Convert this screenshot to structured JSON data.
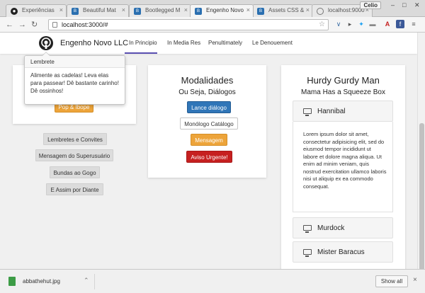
{
  "browser": {
    "tabs": [
      {
        "title": "Experiências",
        "icon": "github-icon"
      },
      {
        "title": "Beautiful Mat",
        "icon": "bootstrap-icon"
      },
      {
        "title": "Bootlegged M",
        "icon": "bootstrap-icon"
      },
      {
        "title": "Engenho Novo",
        "icon": "bootstrap-icon"
      },
      {
        "title": "Assets CSS &",
        "icon": "bootstrap-icon"
      },
      {
        "title": "localhost:9000",
        "icon": "globe-icon"
      }
    ],
    "profile_label": "Celio",
    "url": "localhost:3000/#"
  },
  "navbar": {
    "brand": "Engenho Novo LLC",
    "links": [
      "In Principio",
      "In Media Res",
      "Penultimately",
      "Le Denouement"
    ]
  },
  "left": {
    "popover": {
      "title": "Lembrete",
      "body": "Alimente as cadelas! Leva elas para passear! Dê bastante carinho! Dê ossinhos!"
    },
    "primary_button": "Pop & Ibope",
    "buttons": [
      "Lembretes e Convites",
      "Mensagem do Superusuário",
      "Bundas ao Gogo",
      "E Assim por Diante"
    ]
  },
  "middle": {
    "title": "Modalidades",
    "subtitle": "Ou Seja, Diálogos",
    "buttons": [
      "Lance diálogo",
      "Monólogo Catálogo",
      "Mensagem",
      "Aviso Urgente!"
    ]
  },
  "right": {
    "title": "Hurdy Gurdy Man",
    "subtitle": "Mama Has a Squeeze Box",
    "accordion": [
      {
        "label": "Hannibal",
        "body": "Lorem ipsum dolor sit amet, consectetur adipisicing elit, sed do eiusmod tempor incididunt ut labore et dolore magna aliqua. Ut enim ad minim veniam, quis nostrud exercitation ullamco laboris nisi ut aliquip ex ea commodo consequat."
      },
      {
        "label": "Murdock"
      },
      {
        "label": "Mister Baracus"
      }
    ]
  },
  "downloads": {
    "file": "abbathehut.jpg",
    "show_all": "Show all"
  },
  "colors": {
    "primary": "#3076b8",
    "warning": "#eda43a",
    "danger": "#c62020",
    "nav_accent": "#5a4fb0"
  }
}
